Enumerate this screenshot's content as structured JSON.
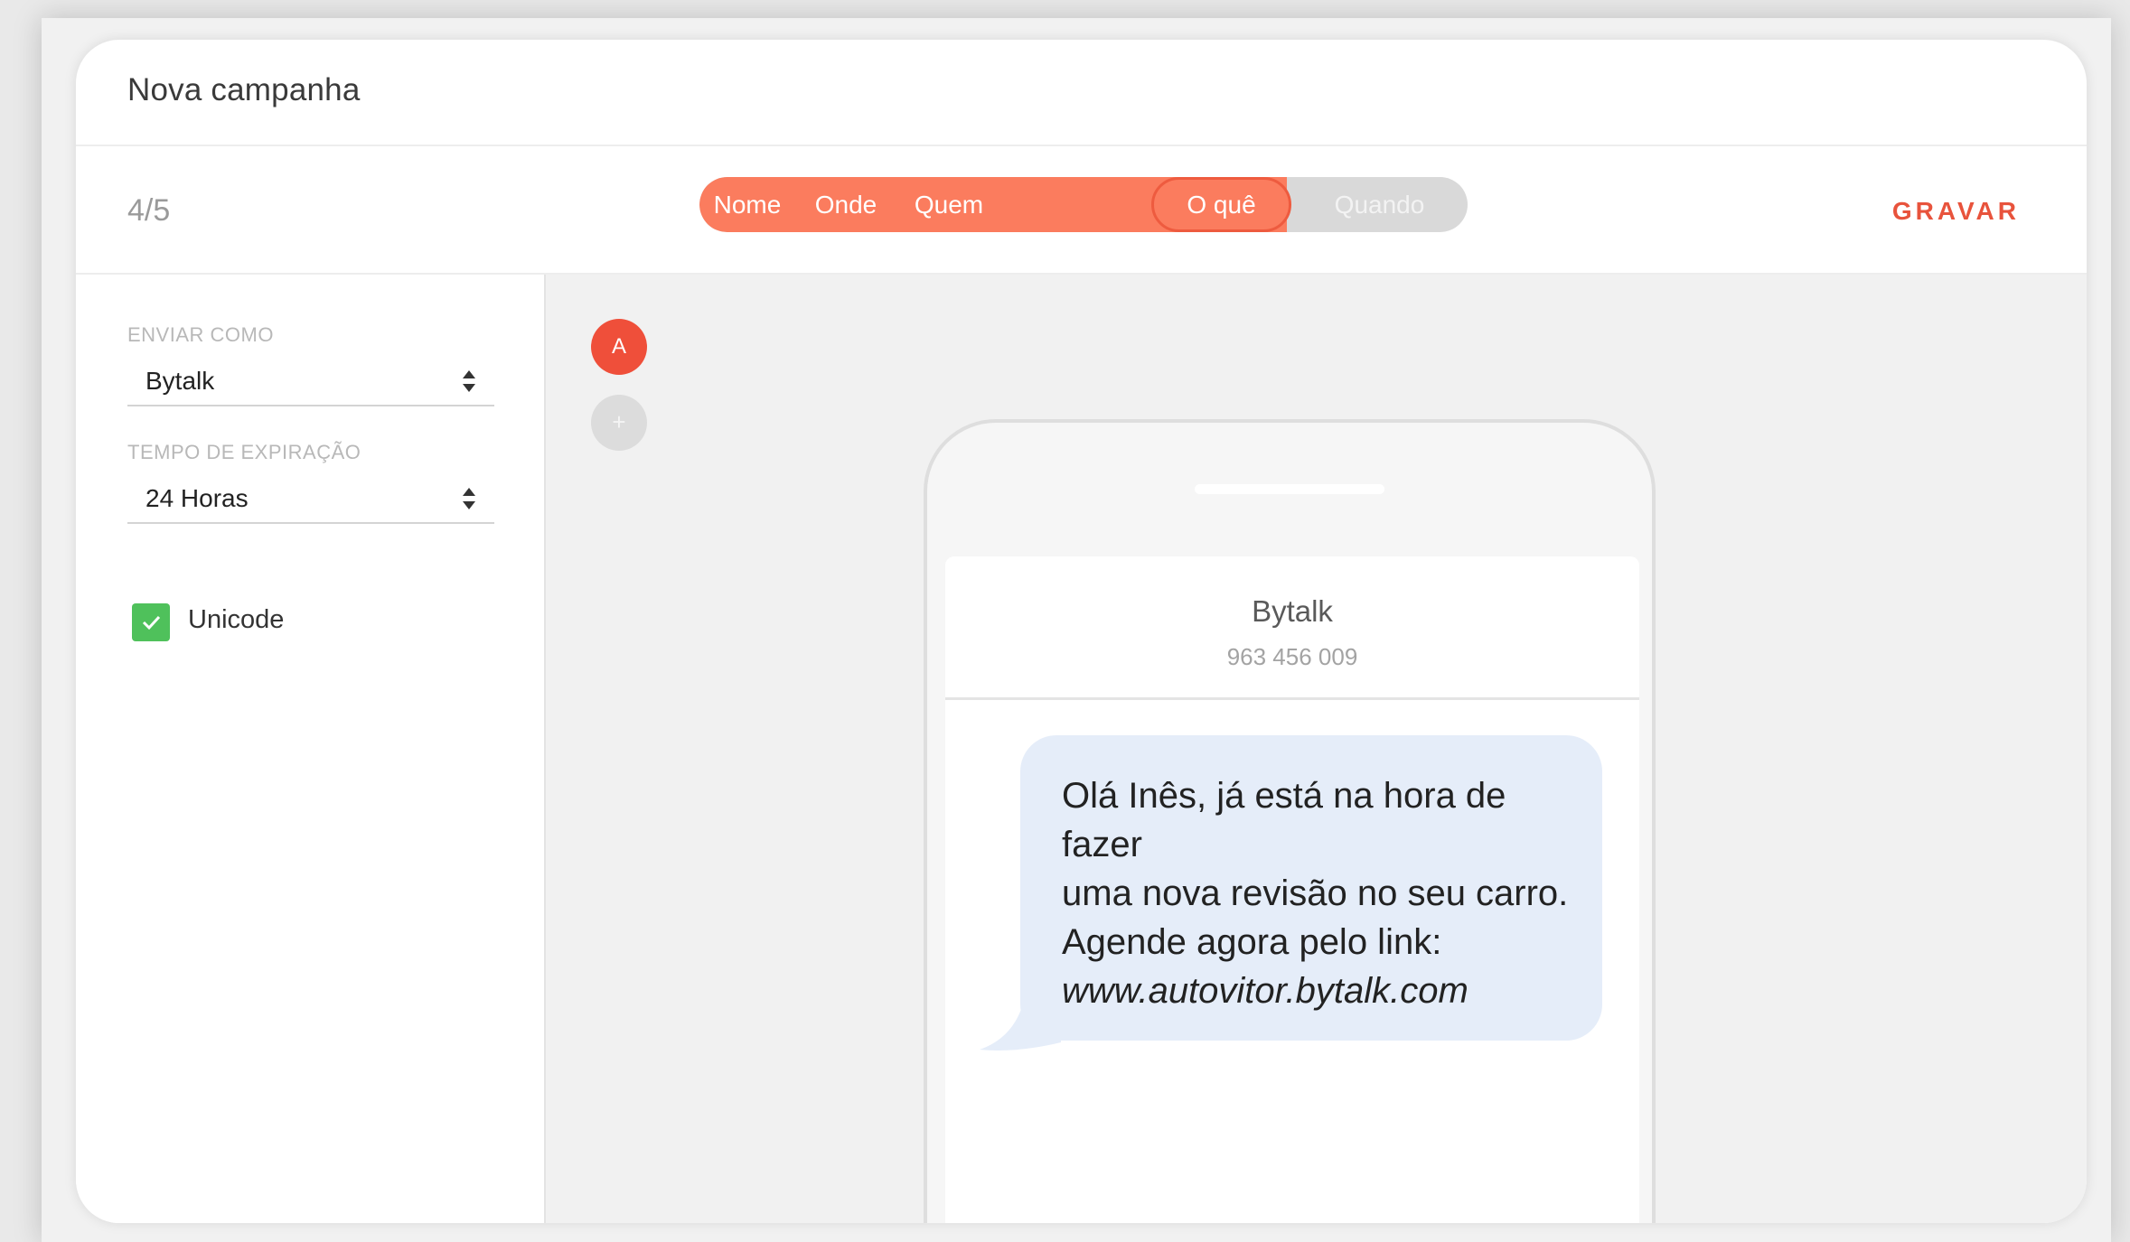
{
  "header": {
    "title": "Nova campanha"
  },
  "toolbar": {
    "step_count": "4/5",
    "steps": [
      {
        "label": "Nome",
        "state": "done"
      },
      {
        "label": "Onde",
        "state": "done"
      },
      {
        "label": "Quem",
        "state": "done"
      },
      {
        "label": "O quê",
        "state": "current"
      },
      {
        "label": "Quando",
        "state": "pending"
      }
    ],
    "save_label": "GRAVAR"
  },
  "settings": {
    "send_as": {
      "label": "ENVIAR COMO",
      "value": "Bytalk"
    },
    "expiration": {
      "label": "TEMPO DE EXPIRAÇÃO",
      "value": "24 Horas"
    },
    "unicode": {
      "label": "Unicode",
      "checked": true
    }
  },
  "message_tabs": {
    "active": "A",
    "add": "+"
  },
  "preview": {
    "contact_name": "Bytalk",
    "contact_number": "963 456 009",
    "message_lines": [
      "Olá Inês, já está na hora de fazer",
      "uma nova revisão no seu carro.",
      "Agende agora pelo link:"
    ],
    "message_link": "www.autovitor.bytalk.com"
  },
  "colors": {
    "accent": "#fb7c5e",
    "save": "#e8533c",
    "tab_active": "#ef4f3a",
    "checkbox": "#4fc15b",
    "bubble": "#e5edf9"
  }
}
